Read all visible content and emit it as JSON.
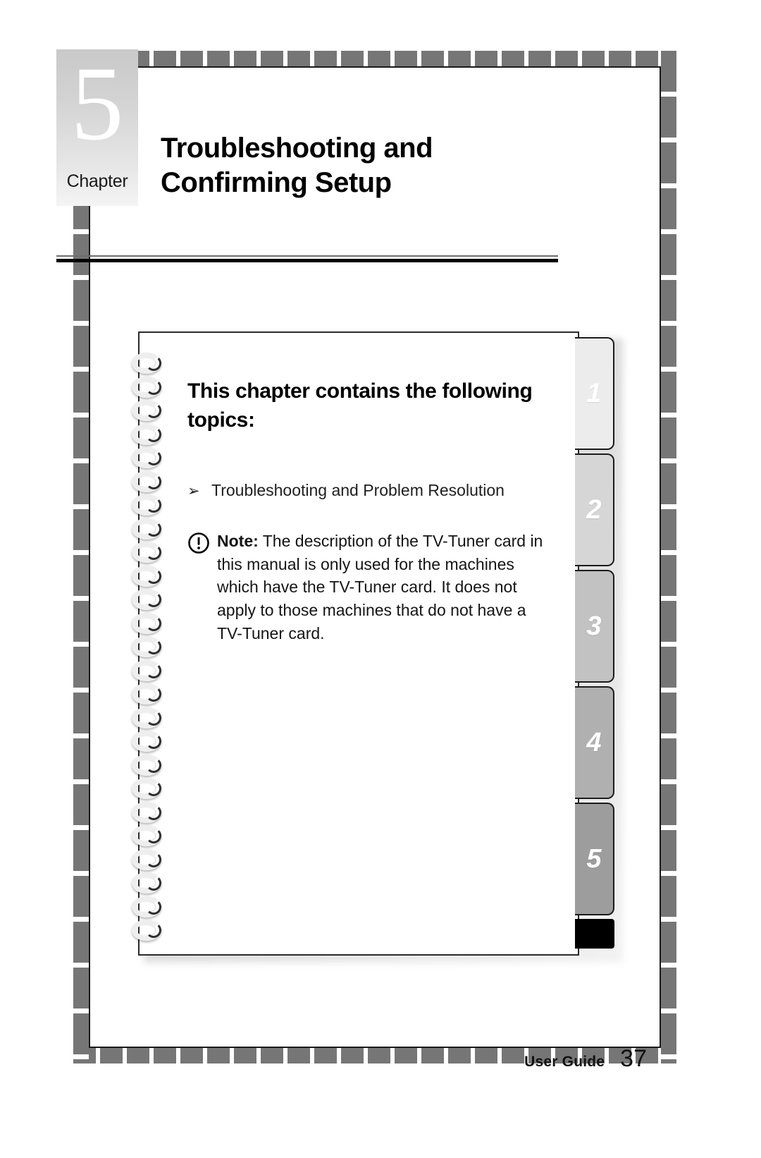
{
  "document": {
    "chapter_number": "5",
    "chapter_word": "Chapter",
    "chapter_title_line1": "Troubleshooting and",
    "chapter_title_line2": "Confirming Setup"
  },
  "panel": {
    "heading": "This chapter contains the following topics:",
    "topics": [
      {
        "bullet": "➢",
        "label": "Troubleshooting and Problem Resolution"
      }
    ],
    "note": {
      "icon": "exclamation-circle-icon",
      "label": "Note:",
      "body": " The description of the TV-Tuner card in this manual is only used for the machines which have the TV-Tuner card. It does not apply to those machines that do not have a TV-Tuner card."
    }
  },
  "tabs": [
    {
      "label": "1",
      "color": "#ececec"
    },
    {
      "label": "2",
      "color": "#d6d6d6"
    },
    {
      "label": "3",
      "color": "#c2c2c2"
    },
    {
      "label": "4",
      "color": "#b0b0b0"
    },
    {
      "label": "5",
      "color": "#9d9d9d"
    }
  ],
  "footer": {
    "label": "User Guide",
    "page": "37"
  },
  "colors": {
    "frame_gray": "#767676",
    "rule_black": "#000000",
    "badge_gradient_top": "#c9c9c9",
    "badge_gradient_bottom": "#f4f4f4"
  }
}
